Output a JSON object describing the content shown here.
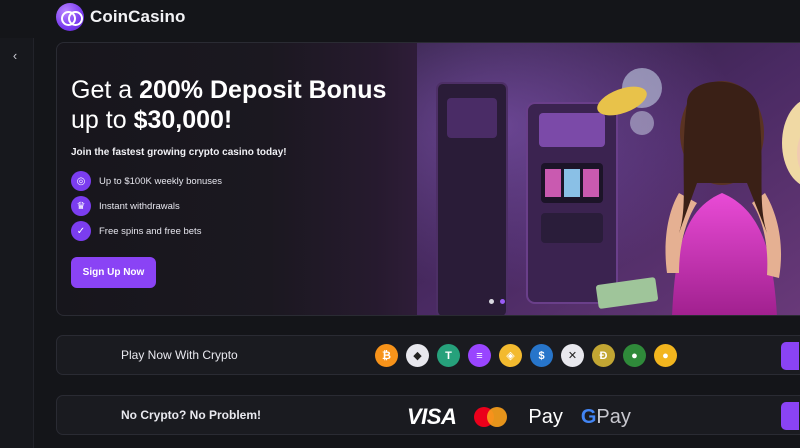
{
  "header": {
    "brand": "CoinCasino"
  },
  "rail": {
    "collapse_glyph": "‹"
  },
  "hero": {
    "title_line1_pre": "Get a ",
    "title_line1_bold": "200% Deposit Bonus",
    "title_line2_pre": "up to ",
    "title_line2_bold": "$30,000!",
    "subtitle": "Join the fastest growing crypto casino today!",
    "features": [
      {
        "icon": "coins-icon",
        "label": "Up to $100K weekly bonuses"
      },
      {
        "icon": "trophy-icon",
        "label": "Instant withdrawals"
      },
      {
        "icon": "shield-icon",
        "label": "Free spins and free bets"
      }
    ],
    "cta": "Sign Up Now",
    "slides": 2,
    "active_slide": 2
  },
  "crypto_row": {
    "label": "Play Now With Crypto",
    "coins": [
      {
        "name": "bitcoin-icon",
        "glyph": "₿",
        "color": "#f7931a"
      },
      {
        "name": "ethereum-icon",
        "glyph": "◆",
        "color": "#e8e8ee"
      },
      {
        "name": "tether-icon",
        "glyph": "T",
        "color": "#26a17b"
      },
      {
        "name": "solana-icon",
        "glyph": "≡",
        "color": "#9945ff"
      },
      {
        "name": "bnb-icon",
        "glyph": "◈",
        "color": "#f3ba2f"
      },
      {
        "name": "usdc-icon",
        "glyph": "$",
        "color": "#2775ca"
      },
      {
        "name": "xrp-icon",
        "glyph": "✕",
        "color": "#e8e8ee"
      },
      {
        "name": "dogecoin-icon",
        "glyph": "Ð",
        "color": "#c2a633"
      },
      {
        "name": "polygon-icon",
        "glyph": "●",
        "color": "#2f8a3a"
      },
      {
        "name": "shiba-icon",
        "glyph": "●",
        "color": "#f2b51e"
      }
    ]
  },
  "fiat_row": {
    "label": "No Crypto? No Problem!",
    "visa": "VISA",
    "apple_pay": "Pay",
    "google_pay_g": "G",
    "google_pay_text": "Pay"
  }
}
